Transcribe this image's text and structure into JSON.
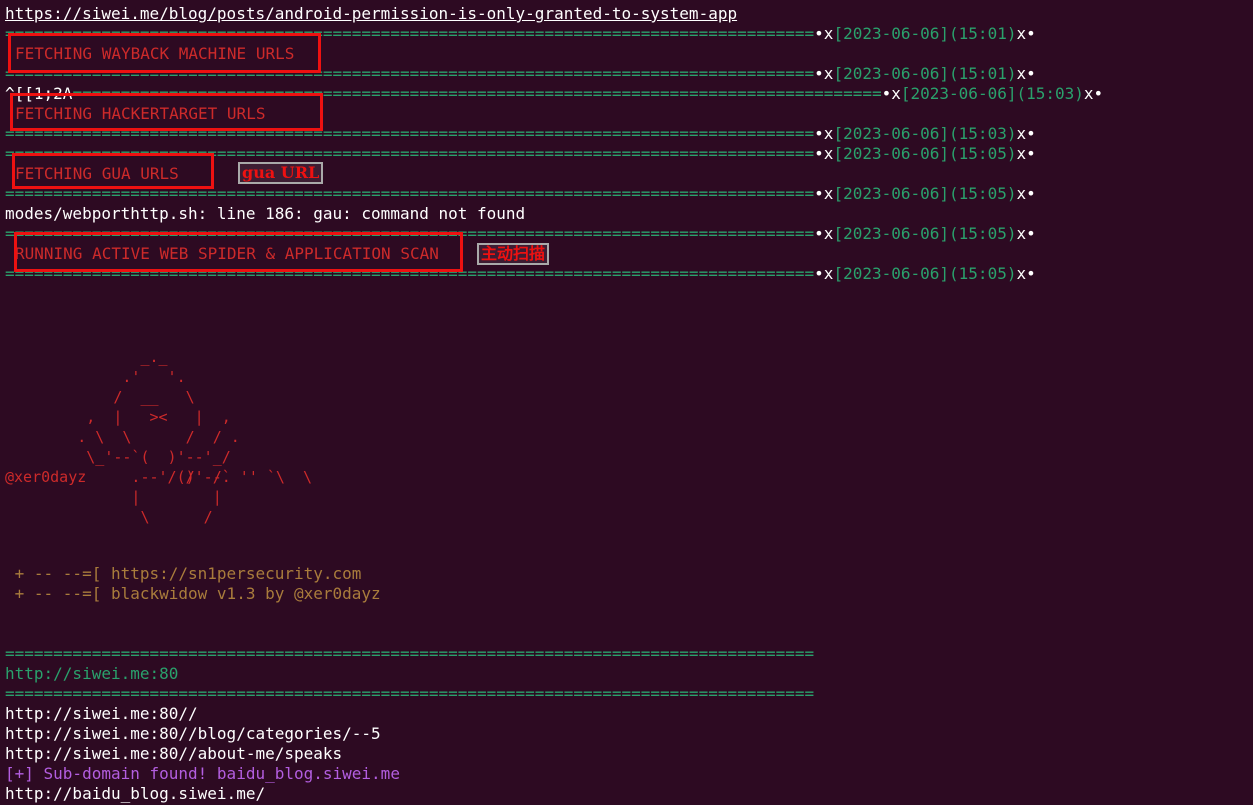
{
  "terminal": {
    "top_url": "https://siwei.me/blog/posts/android-permission-is-only-granted-to-system-app",
    "separator": "====================================================================================",
    "separator_short": "========================================================================================================================================================",
    "bullet": "•",
    "x": "x",
    "ts_1501": "[2023-06-06](15:01)",
    "ts_1503": "[2023-06-06](15:03)",
    "ts_1505": "[2023-06-06](15:05)",
    "fetch_wayback": "FETCHING WAYBACK MACHINE URLS",
    "escape_seq": "^[[1;2A",
    "fetch_hackertarget": "FETCHING HACKERTARGET URLS",
    "fetch_gua": "FETCHING GUA URLS",
    "error_line": "modes/webporthttp.sh: line 186: gau: command not found",
    "running_spider": "RUNNING ACTIVE WEB SPIDER & APPLICATION SCAN",
    "handle": "@xer0dayz",
    "banner_site": " + -- --=[ https://sn1persecurity.com",
    "banner_version": " + -- --=[ blackwidow v1.3 by @xer0dayz",
    "target_host": "http://siwei.me:80",
    "crawl_1": "http://siwei.me:80//",
    "crawl_2": "http://siwei.me:80//blog/categories/--5",
    "crawl_3": "http://siwei.me:80//about-me/speaks",
    "subdomain_found": "[+] Sub-domain found! baidu_blog.siwei.me",
    "crawl_4": "http://baidu_blog.siwei.me/"
  },
  "annotations": {
    "gua_tag": "gua URL",
    "active_scan_tag": "主动扫描"
  },
  "ascii_art": {
    "l1": "               _._",
    "l2": "             .'   '.",
    "l3": "            /  __   \\",
    "l4": "         ,  |   ><   |  ,",
    "l5": "        . \\  \\      /  / .",
    "l6": "         \\_'--`(  )'--'_/",
    "l7": "              .--'/()'--.",
    "l8": "           /  /` '' `\\  \\",
    "l9": "              |        |",
    "l10": "               \\      /"
  },
  "colors": {
    "background": "#2d0a22",
    "separator_green": "#2aa16c",
    "error_red": "#cd2a2a",
    "highlight_box": "#ee1111",
    "subdomain_purple": "#b35ee0",
    "banner_brown": "#a97c3c"
  }
}
